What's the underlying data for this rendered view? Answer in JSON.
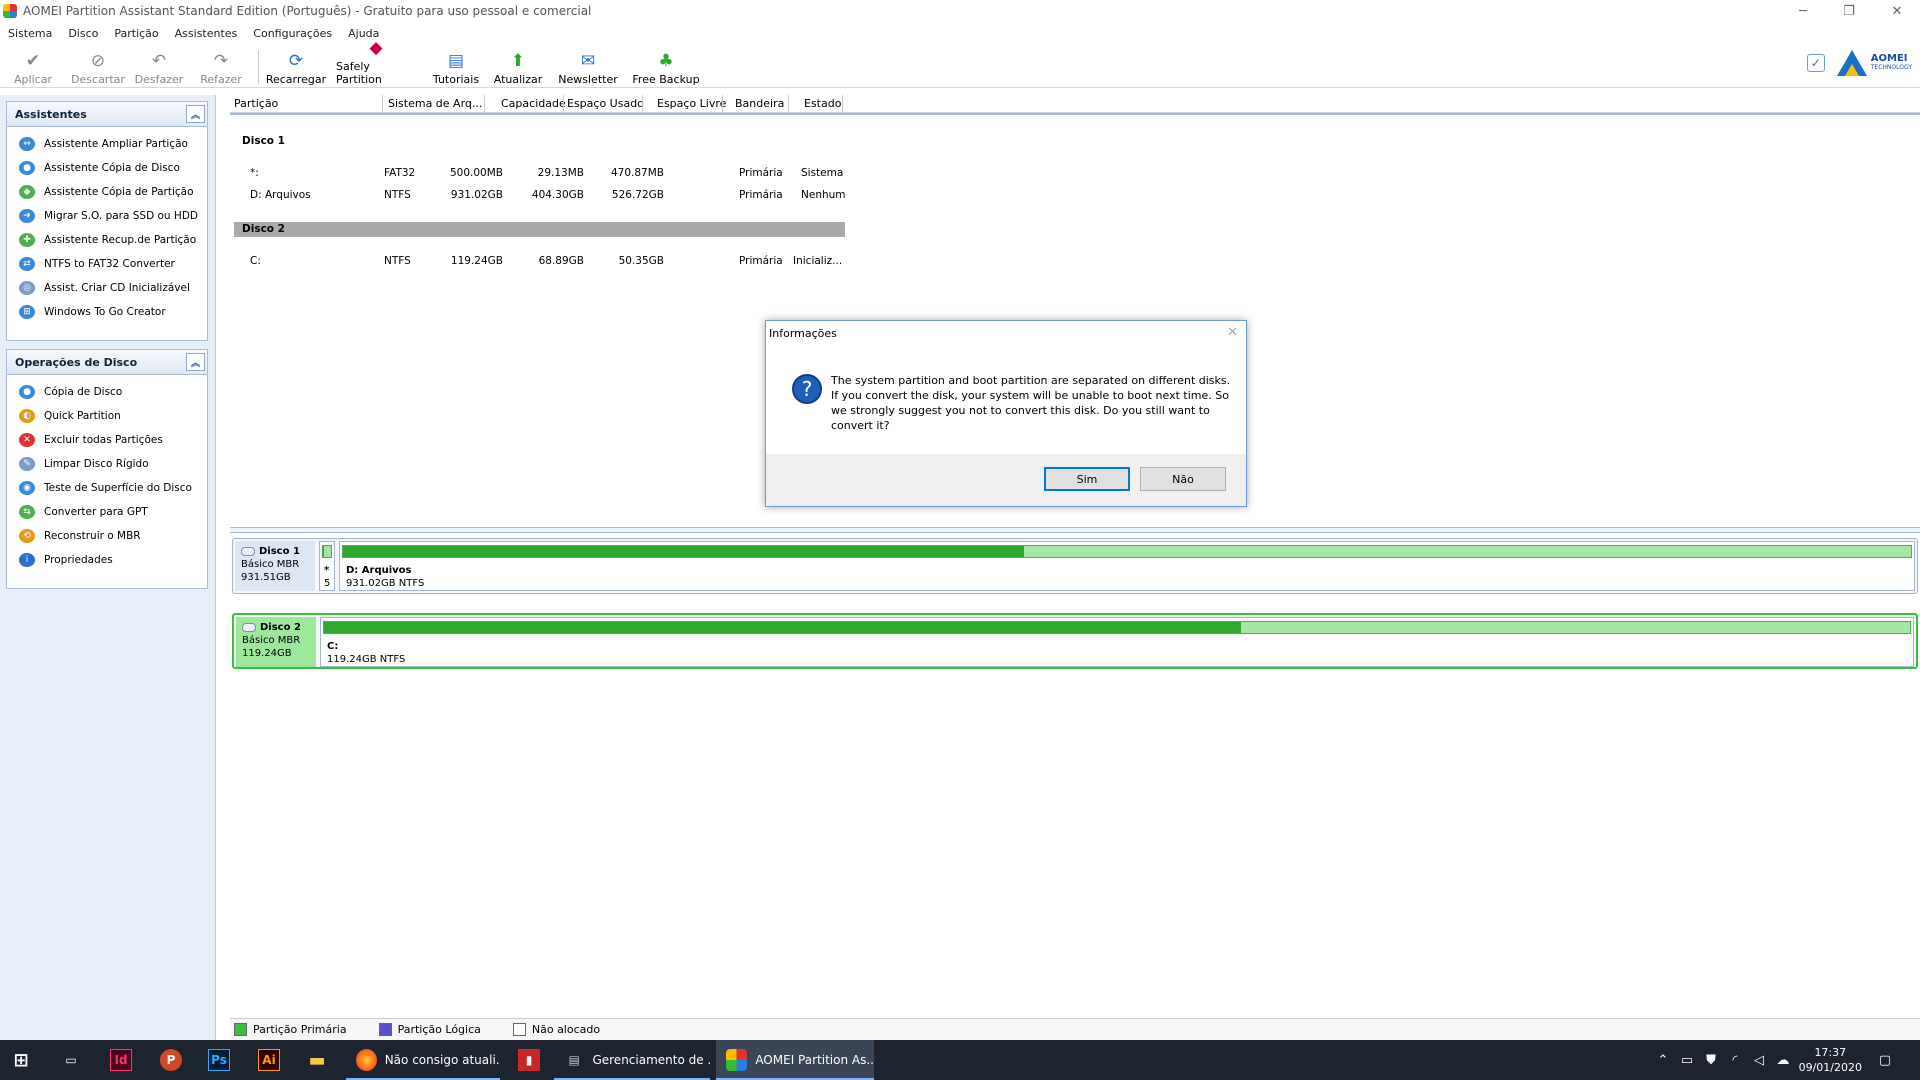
{
  "window": {
    "title": "AOMEI Partition Assistant Standard Edition (Português) - Gratuito para uso pessoal e comercial"
  },
  "menu": [
    "Sistema",
    "Disco",
    "Partição",
    "Assistentes",
    "Configurações",
    "Ajuda"
  ],
  "toolbar": {
    "aplicar": "Aplicar",
    "descartar": "Descartar",
    "desfazer": "Desfazer",
    "refazer": "Refazer",
    "recarregar": "Recarregar",
    "safely": "Safely Partition",
    "tutoriais": "Tutoriais",
    "atualizar": "Atualizar",
    "newsletter": "Newsletter",
    "freebackup": "Free Backup"
  },
  "brand": {
    "name": "AOMEI",
    "sub": "TECHNOLOGY"
  },
  "sidebar": {
    "assistentes": {
      "title": "Assistentes",
      "items": [
        "Assistente Ampliar Partição",
        "Assistente Cópia de Disco",
        "Assistente Cópia de Partição",
        "Migrar S.O. para SSD ou HDD",
        "Assistente Recup.de Partição",
        "NTFS to FAT32 Converter",
        "Assist. Criar CD Inicializável",
        "Windows To Go Creator"
      ]
    },
    "operacoes": {
      "title": "Operações de Disco",
      "items": [
        "Cópia de Disco",
        "Quick Partition",
        "Excluir todas Partições",
        "Limpar Disco Rígido",
        "Teste de Superfície do Disco",
        "Converter para GPT",
        "Reconstruir o MBR",
        "Propriedades"
      ]
    }
  },
  "columns": [
    "Partição",
    "Sistema de Arq...",
    "Capacidade",
    "Espaço Usado",
    "Espaço Livre",
    "Bandeira",
    "Estado"
  ],
  "disks_table": {
    "disk1": {
      "name": "Disco 1",
      "rows": [
        [
          "*:",
          "FAT32",
          "500.00MB",
          "29.13MB",
          "470.87MB",
          "Primária",
          "Sistema"
        ],
        [
          "D: Arquivos",
          "NTFS",
          "931.02GB",
          "404.30GB",
          "526.72GB",
          "Primária",
          "Nenhum"
        ]
      ]
    },
    "disk2": {
      "name": "Disco 2",
      "rows": [
        [
          "C:",
          "NTFS",
          "119.24GB",
          "68.89GB",
          "50.35GB",
          "Primária",
          "Inicializ..."
        ]
      ]
    }
  },
  "diskmap": {
    "disk1": {
      "name": "Disco 1",
      "type": "Básico MBR",
      "size": "931.51GB",
      "small_label": "*",
      "small_num": "5",
      "part_name": "D: Arquivos",
      "part_info": "931.02GB NTFS",
      "used_fraction": 0.434
    },
    "disk2": {
      "name": "Disco 2",
      "type": "Básico MBR",
      "size": "119.24GB",
      "part_name": "C:",
      "part_info": "119.24GB NTFS",
      "used_fraction": 0.578
    }
  },
  "dialog": {
    "title": "Informações",
    "message": "The system partition and boot partition are separated on different disks. If you convert the disk, your system will be unable to boot next time. So we strongly suggest you not to convert this disk. Do you still want to convert it?",
    "yes": "Sim",
    "no": "Não"
  },
  "legend": {
    "primary": "Partição Primária",
    "logical": "Partição Lógica",
    "unalloc": "Não alocado"
  },
  "taskbar": {
    "firefox": "Não consigo atuali...",
    "gerenciamento": "Gerenciamento de ...",
    "aomei": "AOMEI Partition As...",
    "time": "17:37",
    "date": "09/01/2020"
  },
  "colors": {
    "accent": "#0078d7",
    "used": "#2fa82f",
    "free": "#a5e6a5",
    "taskbar": "#1d2430"
  }
}
